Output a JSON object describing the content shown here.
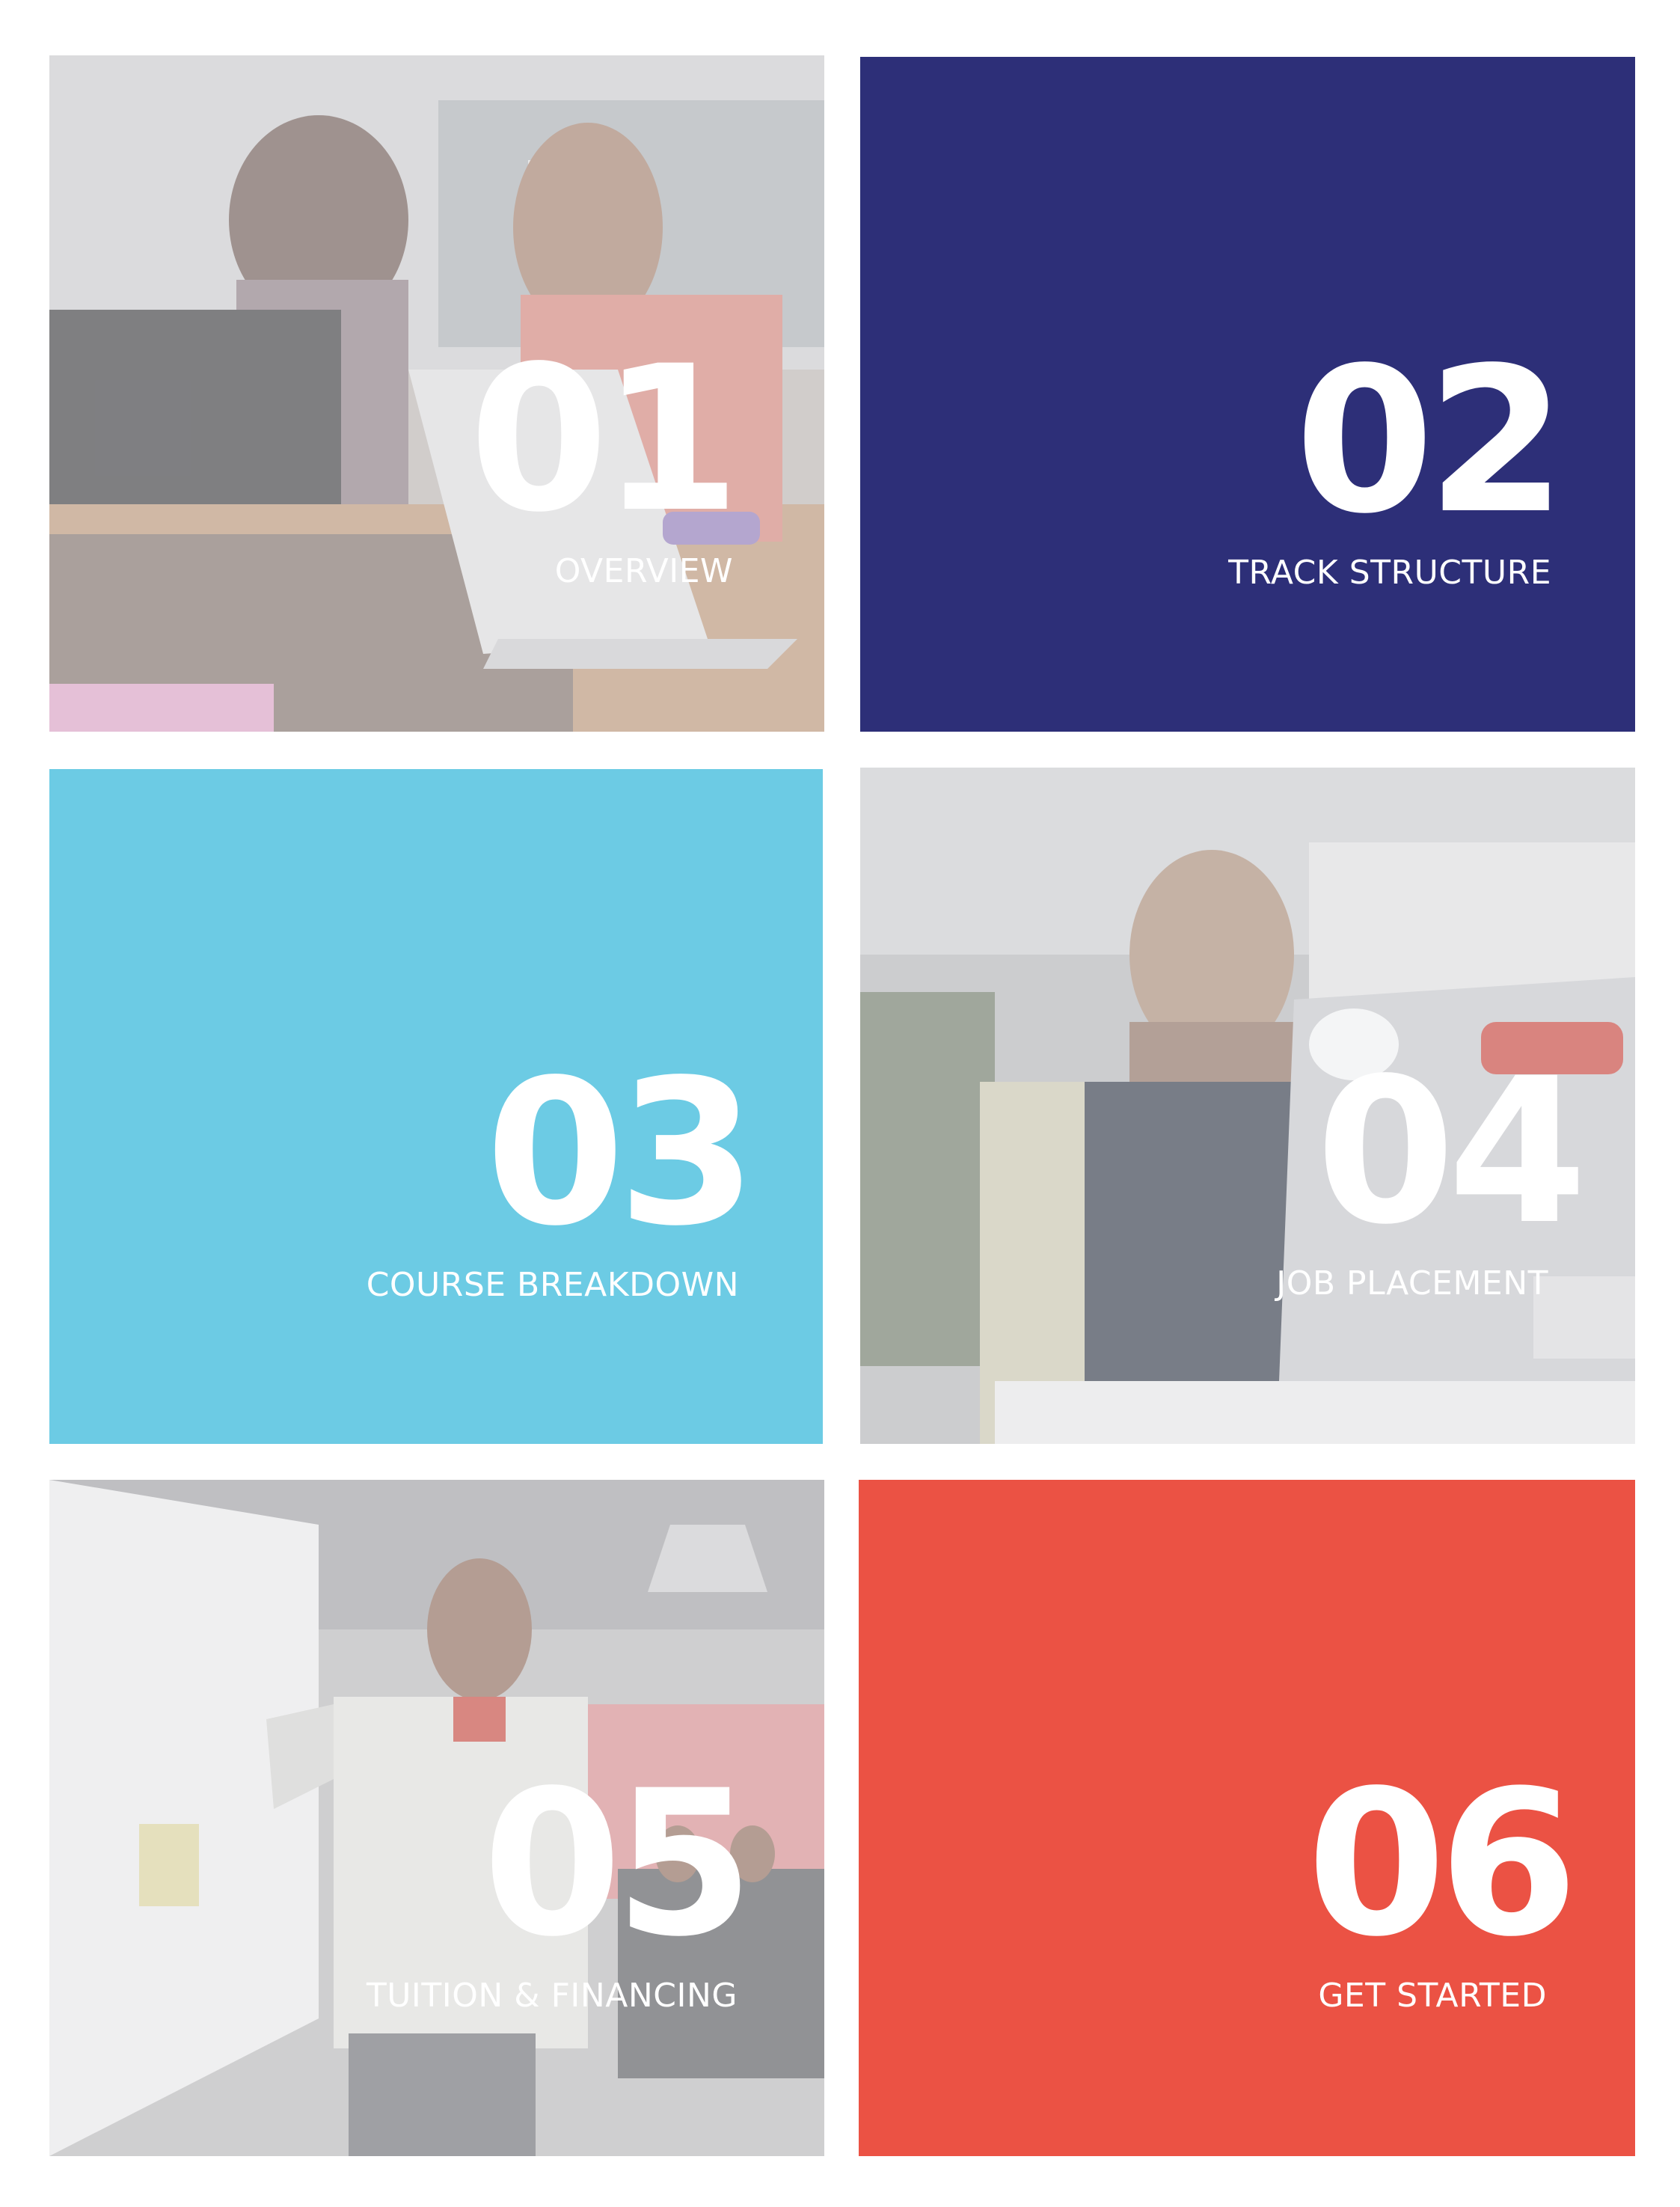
{
  "colors": {
    "navy": "#2d2f78",
    "sky": "#6ccbe4",
    "red": "#eb5244",
    "text": "#ffffff"
  },
  "tiles": [
    {
      "number": "01",
      "label": "OVERVIEW",
      "background": "photo",
      "photo_subject": "two women talking at laptops"
    },
    {
      "number": "02",
      "label": "TRACK STRUCTURE",
      "background": "#2d2f78"
    },
    {
      "number": "03",
      "label": "COURSE BREAKDOWN",
      "background": "#6ccbe4"
    },
    {
      "number": "04",
      "label": "JOB PLACEMENT",
      "background": "photo",
      "photo_subject": "man working on laptop"
    },
    {
      "number": "05",
      "label": "TUITION & FINANCING",
      "background": "photo",
      "photo_subject": "instructor at whiteboard"
    },
    {
      "number": "06",
      "label": "GET STARTED",
      "background": "#eb5244"
    }
  ]
}
